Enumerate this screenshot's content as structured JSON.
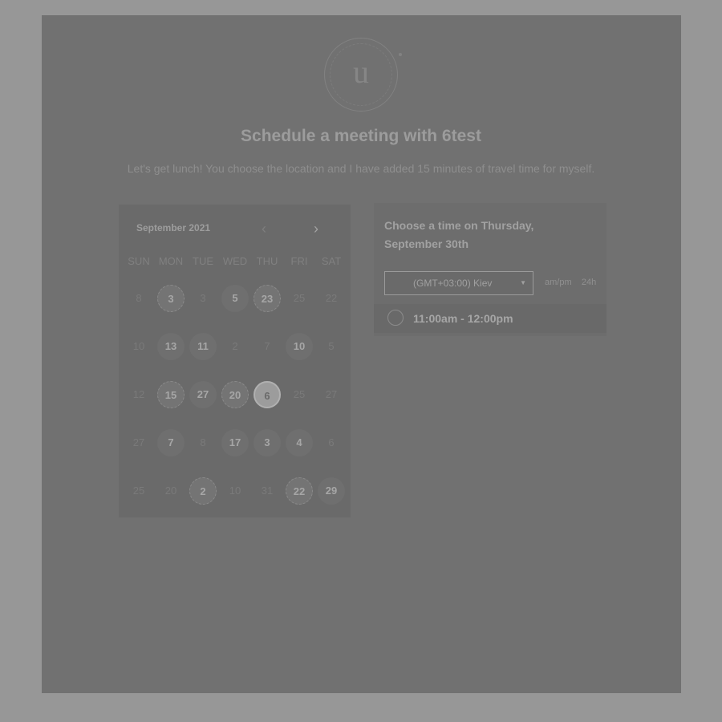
{
  "logo": {
    "letter": "u"
  },
  "header": {
    "title": "Schedule a meeting with 6test",
    "subtitle": "Let's get lunch! You choose the location and I have added 15 minutes of travel time for myself."
  },
  "calendar": {
    "month_label": "September 2021",
    "prev_icon": "‹",
    "next_icon": "›",
    "weekdays": [
      "SUN",
      "MON",
      "TUE",
      "WED",
      "THU",
      "FRI",
      "SAT"
    ],
    "weeks": [
      [
        {
          "d": "8",
          "s": "off"
        },
        {
          "d": "3",
          "s": "dotted"
        },
        {
          "d": "3",
          "s": "off"
        },
        {
          "d": "5",
          "s": "avail"
        },
        {
          "d": "23",
          "s": "dotted"
        },
        {
          "d": "25",
          "s": "off"
        },
        {
          "d": "22",
          "s": "off"
        }
      ],
      [
        {
          "d": "10",
          "s": "off"
        },
        {
          "d": "13",
          "s": "avail"
        },
        {
          "d": "11",
          "s": "avail"
        },
        {
          "d": "2",
          "s": "off"
        },
        {
          "d": "7",
          "s": "off"
        },
        {
          "d": "10",
          "s": "avail"
        },
        {
          "d": "5",
          "s": "off"
        }
      ],
      [
        {
          "d": "12",
          "s": "off"
        },
        {
          "d": "15",
          "s": "dotted"
        },
        {
          "d": "27",
          "s": "avail"
        },
        {
          "d": "20",
          "s": "dotted"
        },
        {
          "d": "6",
          "s": "selected"
        },
        {
          "d": "25",
          "s": "off"
        },
        {
          "d": "27",
          "s": "off"
        }
      ],
      [
        {
          "d": "27",
          "s": "off"
        },
        {
          "d": "7",
          "s": "avail"
        },
        {
          "d": "8",
          "s": "off"
        },
        {
          "d": "17",
          "s": "avail"
        },
        {
          "d": "3",
          "s": "avail"
        },
        {
          "d": "4",
          "s": "avail"
        },
        {
          "d": "6",
          "s": "off"
        }
      ],
      [
        {
          "d": "25",
          "s": "off"
        },
        {
          "d": "20",
          "s": "off"
        },
        {
          "d": "2",
          "s": "dotted"
        },
        {
          "d": "10",
          "s": "off"
        },
        {
          "d": "31",
          "s": "off"
        },
        {
          "d": "22",
          "s": "dotted"
        },
        {
          "d": "29",
          "s": "avail"
        }
      ]
    ]
  },
  "time_picker": {
    "title": "Choose a time on Thursday, September 30th",
    "timezone": "(GMT+03:00) Kiev",
    "format_12": "am/pm",
    "format_24": "24h",
    "slots": [
      "11:00am - 12:00pm"
    ]
  }
}
